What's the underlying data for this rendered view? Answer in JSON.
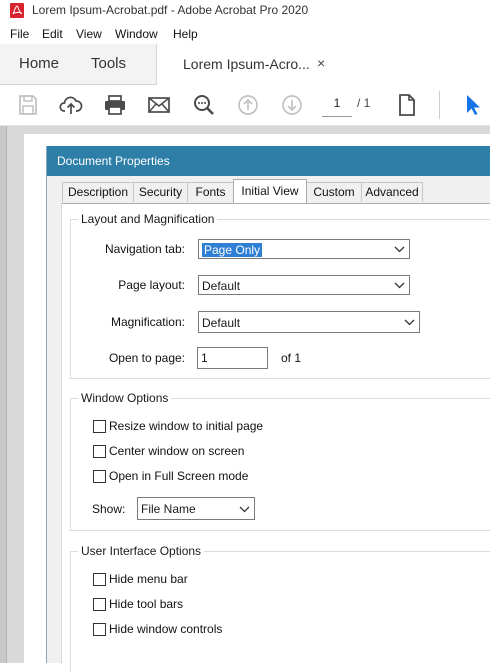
{
  "window": {
    "title": "Lorem Ipsum-Acrobat.pdf - Adobe Acrobat Pro 2020",
    "icon": "acrobat-icon"
  },
  "menu": [
    "File",
    "Edit",
    "View",
    "Window",
    "Help"
  ],
  "tabs": {
    "home": "Home",
    "tools": "Tools",
    "document": "Lorem Ipsum-Acro...",
    "close": "×"
  },
  "toolbar": {
    "icons": [
      "save-icon",
      "cloud-upload-icon",
      "print-icon",
      "email-icon",
      "zoom-search-icon",
      "page-up-icon",
      "page-down-icon",
      "page-thumbnail-icon",
      "select-cursor-icon"
    ],
    "current_page": "1",
    "page_total": "/ 1"
  },
  "dialog": {
    "title": "Document Properties",
    "tabs": [
      "Description",
      "Security",
      "Fonts",
      "Initial View",
      "Custom",
      "Advanced"
    ],
    "active_tab": "Initial View",
    "layout_group": {
      "label": "Layout and Magnification",
      "navigation_tab_label": "Navigation tab:",
      "navigation_tab_value": "Page Only",
      "page_layout_label": "Page layout:",
      "page_layout_value": "Default",
      "magnification_label": "Magnification:",
      "magnification_value": "Default",
      "open_to_page_label": "Open to page:",
      "open_to_page_value": "1",
      "of_pages": "of 1"
    },
    "window_group": {
      "label": "Window Options",
      "resize": "Resize window to initial page",
      "center": "Center window on screen",
      "fullscreen": "Open in Full Screen mode",
      "show_label": "Show:",
      "show_value": "File Name"
    },
    "ui_group": {
      "label": "User Interface Options",
      "hide_menu": "Hide menu bar",
      "hide_toolbars": "Hide tool bars",
      "hide_window_controls": "Hide window controls"
    }
  },
  "colors": {
    "dialog_title_bar": "#2e7fa8",
    "selection": "#2f7fd4",
    "cursor_tool": "#1473e6",
    "acrobat_red": "#d8242d"
  }
}
